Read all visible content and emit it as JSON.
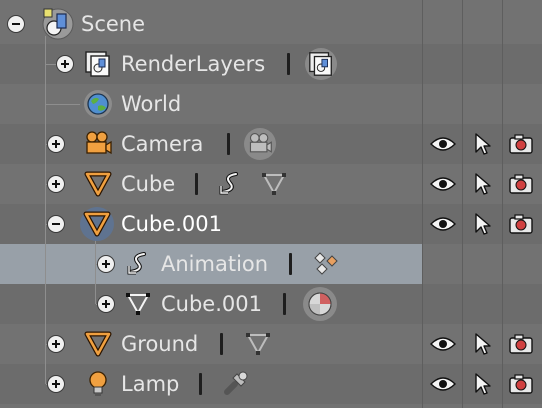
{
  "outliner": {
    "items": [
      {
        "label": "Scene",
        "icon": "scene-icon",
        "expanded": true
      },
      {
        "label": "RenderLayers",
        "icon": "render-layers-icon",
        "expanded": false
      },
      {
        "label": "World",
        "icon": "world-icon"
      },
      {
        "label": "Camera",
        "icon": "camera-icon",
        "expanded": false
      },
      {
        "label": "Cube",
        "icon": "mesh-object-icon",
        "expanded": false
      },
      {
        "label": "Cube.001",
        "icon": "mesh-object-icon",
        "expanded": true,
        "active": true
      },
      {
        "label": "Animation",
        "icon": "animation-icon",
        "expanded": false,
        "selected": true
      },
      {
        "label": "Cube.001",
        "icon": "mesh-data-icon",
        "expanded": false
      },
      {
        "label": "Ground",
        "icon": "mesh-object-icon",
        "expanded": false
      },
      {
        "label": "Lamp",
        "icon": "lamp-icon",
        "expanded": false
      }
    ],
    "restrict_columns": [
      "eye-icon",
      "cursor-arrow-icon",
      "render-camera-icon"
    ]
  },
  "colors": {
    "background": "#727272",
    "alt_row": "#6c6c6c",
    "selected_row": "#98a0a8",
    "mesh_orange": "#f0a040"
  }
}
